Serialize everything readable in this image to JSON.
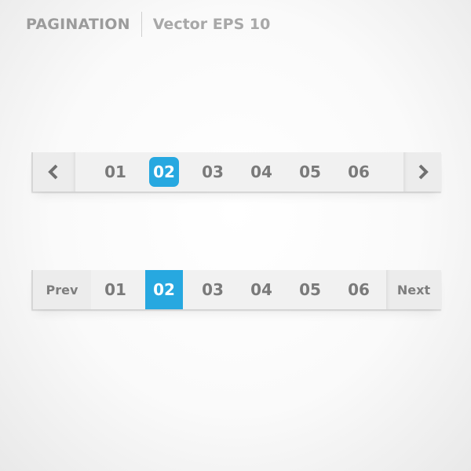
{
  "header": {
    "title": "PAGINATION",
    "subtitle": "Vector EPS 10"
  },
  "colors": {
    "accent": "#27a8e0",
    "text": "#7a7a7a",
    "bar_bg": "#f1f1f1"
  },
  "pagination1": {
    "prev_icon": "chevron-left-icon",
    "next_icon": "chevron-right-icon",
    "pages": [
      "01",
      "02",
      "03",
      "04",
      "05",
      "06"
    ],
    "active_page": "02"
  },
  "pagination2": {
    "prev_label": "Prev",
    "next_label": "Next",
    "pages": [
      "01",
      "02",
      "03",
      "04",
      "05",
      "06"
    ],
    "active_page": "02"
  }
}
